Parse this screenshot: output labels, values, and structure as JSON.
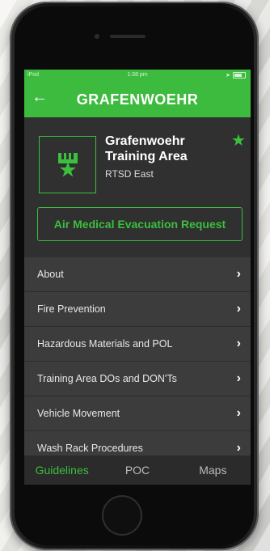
{
  "status_bar": {
    "carrier": "iPod",
    "time": "1:38 pm"
  },
  "header": {
    "title": "GRAFENWOEHR",
    "back_icon": "back-arrow-icon"
  },
  "training_area": {
    "name": "Grafenwoehr Training Area",
    "subtitle": "RTSD East",
    "favorite_icon": "star-icon",
    "logo_icon": "unit-insignia-icon"
  },
  "actions": {
    "medevac_label": "Air Medical Evacuation Request"
  },
  "menu": {
    "items": [
      {
        "label": "About"
      },
      {
        "label": "Fire Prevention"
      },
      {
        "label": "Hazardous Materials and POL"
      },
      {
        "label": "Training Area DOs and DON'Ts"
      },
      {
        "label": "Vehicle Movement"
      },
      {
        "label": "Wash Rack Procedures"
      }
    ]
  },
  "tabs": [
    {
      "label": "Guidelines",
      "active": true
    },
    {
      "label": "POC",
      "active": false
    },
    {
      "label": "Maps",
      "active": false
    }
  ],
  "colors": {
    "accent": "#3bbf3e",
    "topbar": "#3dbb3f",
    "background": "#2f302f",
    "menu_item": "#3b3c3b"
  }
}
